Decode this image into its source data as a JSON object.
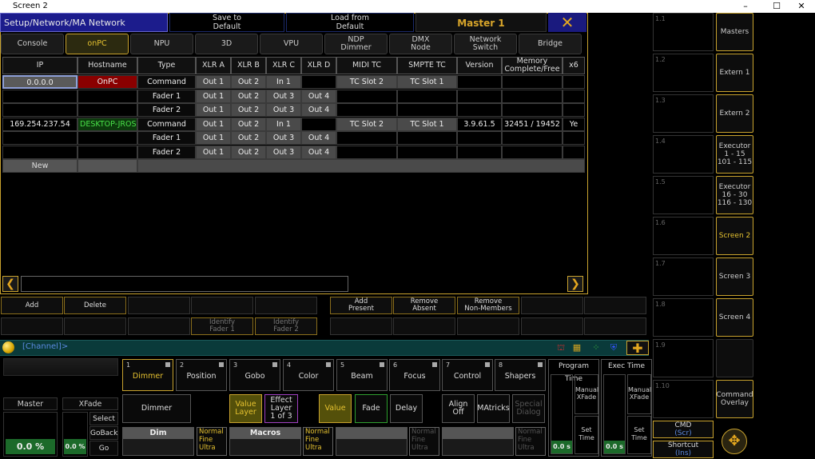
{
  "window": {
    "title": "Screen 2",
    "minimize": "–",
    "maximize": "☐",
    "close": "✕"
  },
  "header": {
    "title": "Setup/Network/MA Network Configuration",
    "save_default": "Save to\nDefault",
    "load_default": "Load from\nDefault",
    "master": "Master 1",
    "close": "✕"
  },
  "tabs": [
    "Console",
    "onPC",
    "NPU",
    "3D",
    "VPU",
    "NDP\nDimmer",
    "DMX\nNode",
    "Network\nSwitch",
    "Bridge"
  ],
  "active_tab": "onPC",
  "table": {
    "columns": [
      "IP",
      "Hostname",
      "Type",
      "XLR A",
      "XLR B",
      "XLR C",
      "XLR D",
      "MIDI TC",
      "SMPTE TC",
      "Version",
      "Memory\nComplete/Free",
      "x6"
    ],
    "rows": [
      [
        "0.0.0.0",
        "OnPC",
        "Command",
        "Out 1",
        "Out 2",
        "In 1",
        "",
        "TC Slot 2",
        "TC Slot 1",
        "",
        "",
        ""
      ],
      [
        "",
        "",
        "Fader 1",
        "Out 1",
        "Out 2",
        "Out 3",
        "Out 4",
        "",
        "",
        "",
        "",
        ""
      ],
      [
        "",
        "",
        "Fader 2",
        "Out 1",
        "Out 2",
        "Out 3",
        "Out 4",
        "",
        "",
        "",
        "",
        ""
      ],
      [
        "169.254.237.54",
        "DESKTOP-JROSO",
        "Command",
        "Out 1",
        "Out 2",
        "In 1",
        "",
        "TC Slot 2",
        "TC Slot 1",
        "3.9.61.5",
        "32451 / 19452",
        "Ye"
      ],
      [
        "",
        "",
        "Fader 1",
        "Out 1",
        "Out 2",
        "Out 3",
        "Out 4",
        "",
        "",
        "",
        "",
        ""
      ],
      [
        "",
        "",
        "Fader 2",
        "Out 1",
        "Out 2",
        "Out 3",
        "Out 4",
        "",
        "",
        "",
        "",
        ""
      ]
    ],
    "new_label": "New"
  },
  "actions_row1": [
    "Add",
    "Delete",
    "",
    "",
    "",
    "Add\nPresent",
    "Remove\nAbsent",
    "Remove\nNon-Members",
    "",
    ""
  ],
  "actions_row2": [
    "",
    "",
    "",
    "Identify\nFader 1",
    "Identify\nFader 2",
    "",
    "",
    "",
    "",
    ""
  ],
  "right_slots": [
    "1.1",
    "1.2",
    "1.3",
    "1.4",
    "1.5",
    "1.6",
    "1.7",
    "1.8",
    "1.9",
    "1.10"
  ],
  "right_buttons": [
    "Masters",
    "Extern 1",
    "Extern 2",
    "Executor\n1 - 15\n101 - 115",
    "Executor\n16 - 30\n116 - 130",
    "Screen 2",
    "Screen 3",
    "Screen 4",
    "",
    "Command\nOverlay"
  ],
  "cmd_btn": {
    "label": "CMD",
    "sub": "(Scr)"
  },
  "shortcut_btn": {
    "label": "Shortcut",
    "sub": "(Ins)"
  },
  "command_line": {
    "prompt": "[Channel]>"
  },
  "bottom_left": {
    "master_label": "Master",
    "xfade_label": "XFade",
    "master_value": "0.0 %",
    "xfade_value": "0.0 %",
    "select": "Select",
    "goback": "GoBack",
    "go": "Go"
  },
  "presets": [
    {
      "num": "1",
      "name": "Dimmer"
    },
    {
      "num": "2",
      "name": "Position"
    },
    {
      "num": "3",
      "name": "Gobo"
    },
    {
      "num": "4",
      "name": "Color"
    },
    {
      "num": "5",
      "name": "Beam"
    },
    {
      "num": "6",
      "name": "Focus"
    },
    {
      "num": "7",
      "name": "Control"
    },
    {
      "num": "8",
      "name": "Shapers"
    }
  ],
  "function_buttons": {
    "dimmer": "Dimmer",
    "value_layer": "Value\nLayer",
    "effect_layer": "Effect\nLayer\n1 of 3",
    "value": "Value",
    "fade": "Fade",
    "delay": "Delay",
    "align": "Align\nOff",
    "matricks": "MAtricks",
    "special": "Special\nDialog"
  },
  "encoders": {
    "enc1": "Dim",
    "enc2": "Macros",
    "mode": "Normal\nFine\nUltra"
  },
  "time_panels": {
    "program_time": "Program Time",
    "exec_time": "Exec Time",
    "manual_xfade": "Manual\nXFade",
    "set_time": "Set\nTime",
    "value": "0.0 s"
  }
}
